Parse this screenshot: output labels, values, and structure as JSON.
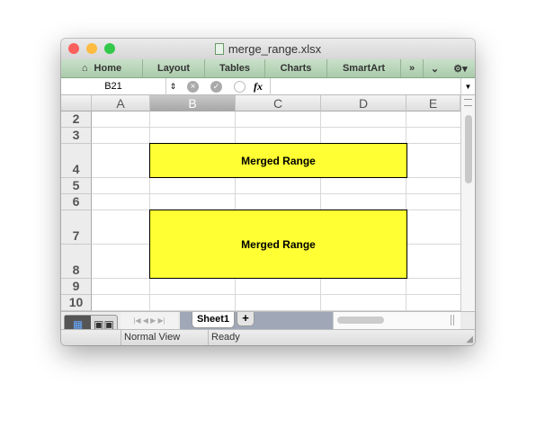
{
  "window": {
    "title": "merge_range.xlsx"
  },
  "toolbar": {
    "items": [
      "Home",
      "Layout",
      "Tables",
      "Charts",
      "SmartArt"
    ]
  },
  "formula_bar": {
    "name_box": "B21",
    "fx": "fx",
    "value": ""
  },
  "columns": [
    "A",
    "B",
    "C",
    "D",
    "E"
  ],
  "rows": [
    "2",
    "3",
    "4",
    "5",
    "6",
    "7",
    "8",
    "9",
    "10"
  ],
  "merged": [
    {
      "range": "B4:D4",
      "text": "Merged Range",
      "fill": "#ffff33"
    },
    {
      "range": "B7:D8",
      "text": "Merged Range",
      "fill": "#ffff33"
    }
  ],
  "sheets": {
    "tabs": [
      "Sheet1"
    ],
    "add": "+"
  },
  "status": {
    "view": "Normal View",
    "state": "Ready"
  }
}
